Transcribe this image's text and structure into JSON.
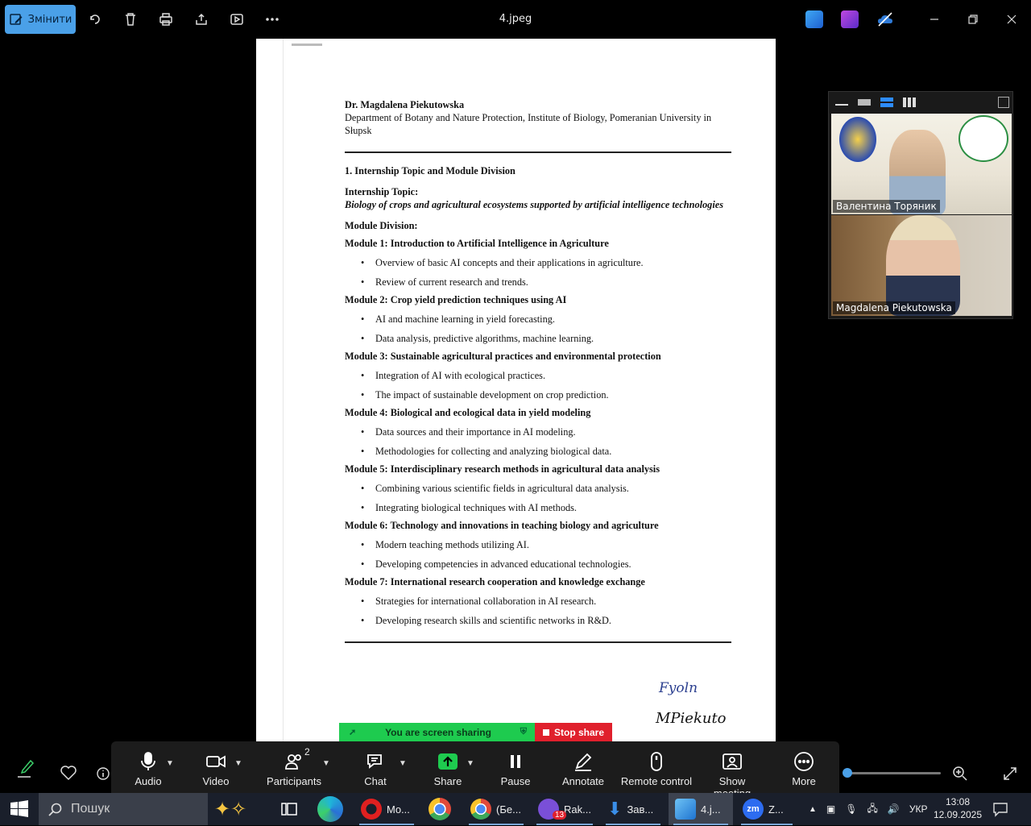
{
  "window": {
    "title": "4.jpeg",
    "edit_label": "Змінити"
  },
  "document": {
    "author": "Dr. Magdalena Piekutowska",
    "affiliation": "Department of Botany and Nature Protection, Institute of Biology, Pomeranian University in Słupsk",
    "section_title": "1. Internship Topic and Module Division",
    "topic_label": "Internship Topic:",
    "topic": "Biology of crops and agricultural ecosystems supported by artificial intelligence technologies",
    "module_division_label": "Module Division:",
    "modules": [
      {
        "title": "Module 1: Introduction to Artificial Intelligence in Agriculture",
        "items": [
          "Overview of basic AI concepts and their applications in agriculture.",
          "Review of current research and trends."
        ]
      },
      {
        "title": "Module 2: Crop yield prediction techniques using AI",
        "items": [
          "AI and machine learning in yield forecasting.",
          "Data analysis, predictive algorithms, machine learning."
        ]
      },
      {
        "title": "Module 3: Sustainable agricultural practices and environmental protection",
        "items": [
          "Integration of AI with ecological practices.",
          "The impact of sustainable development on crop prediction."
        ]
      },
      {
        "title": "Module 4: Biological and ecological data in yield modeling",
        "items": [
          "Data sources and their importance in AI modeling.",
          "Methodologies for collecting and analyzing biological data."
        ]
      },
      {
        "title": "Module 5: Interdisciplinary research methods in agricultural data analysis",
        "items": [
          "Combining various scientific fields in agricultural data analysis.",
          "Integrating biological techniques with AI methods."
        ]
      },
      {
        "title": "Module 6: Technology and innovations in teaching biology and agriculture",
        "items": [
          "Modern teaching methods utilizing AI.",
          "Developing competencies in advanced educational technologies."
        ]
      },
      {
        "title": "Module 7: International research cooperation and knowledge exchange",
        "items": [
          "Strategies for international collaboration in AI research.",
          "Developing research skills and scientific networks in R&D."
        ]
      }
    ],
    "signature_1": "Fyoln",
    "signature_2": "MPiekuto"
  },
  "video": {
    "participants": [
      {
        "name": "Валентина Торяник"
      },
      {
        "name": "Magdalena Piekutowska"
      }
    ]
  },
  "share_banner": {
    "status": "You are screen sharing",
    "stop_label": "Stop share"
  },
  "meeting_controls": {
    "audio": "Audio",
    "video": "Video",
    "participants": "Participants",
    "participants_count": "2",
    "chat": "Chat",
    "share": "Share",
    "pause": "Pause",
    "annotate": "Annotate",
    "remote_control": "Remote control",
    "show_meeting": "Show meeting",
    "more": "More"
  },
  "taskbar": {
    "search_placeholder": "Пошук",
    "apps": [
      {
        "label": "Mo..."
      },
      {
        "label": "(Бе..."
      },
      {
        "label": "Rak...",
        "badge": "13"
      },
      {
        "label": "Зав..."
      },
      {
        "label": "4.j..."
      },
      {
        "label": "Z..."
      }
    ],
    "language": "УКР",
    "time": "13:08",
    "date": "12.09.2025"
  },
  "colors": {
    "accent": "#4aa0e8",
    "share_green": "#1ecb4f",
    "stop_red": "#e0202c"
  }
}
